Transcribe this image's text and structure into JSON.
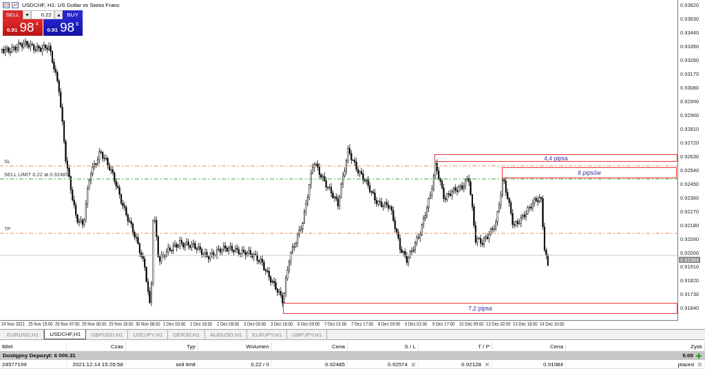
{
  "chart": {
    "title": "USDCHF, H1:  US Dollar vs Swiss Franc",
    "one_click": {
      "sell": {
        "label": "SELL",
        "price_small": "0.91",
        "price_big": "98",
        "price_sup": "4"
      },
      "lot": "0.22",
      "buy": {
        "label": "BUY",
        "price_small": "0.91",
        "price_big": "98",
        "price_sup": "6"
      }
    },
    "price_axis": [
      "0.93620",
      "0.93530",
      "0.93440",
      "0.93350",
      "0.93260",
      "0.93170",
      "0.93080",
      "0.92990",
      "0.92900",
      "0.92810",
      "0.92720",
      "0.92630",
      "0.92540",
      "0.92450",
      "0.92360",
      "0.92270",
      "0.92180",
      "0.92090",
      "0.92000",
      "0.91910",
      "0.91820",
      "0.91730",
      "0.91640"
    ],
    "current_price": "0.91984",
    "time_axis": [
      "24 Nov 2021",
      "25 Nov 15:00",
      "26 Nov 07:00",
      "29 Nov 00:00",
      "29 Nov 16:00",
      "30 Nov 08:00",
      "1 Dec 00:00",
      "1 Dec 16:00",
      "2 Dec 08:00",
      "3 Dec 00:00",
      "3 Dec 16:00",
      "6 Dec 09:00",
      "7 Dec 01:00",
      "7 Dec 17:00",
      "8 Dec 09:00",
      "9 Dec 01:00",
      "9 Dec 17:00",
      "10 Dec 09:00",
      "13 Dec 02:00",
      "13 Dec 18:00",
      "14 Dec 10:00"
    ],
    "levels": [
      {
        "kind": "sl",
        "label": "SL"
      },
      {
        "kind": "order",
        "label": "SELL LIMIT 0.22 at 0.92485"
      },
      {
        "kind": "tp",
        "label": "TP"
      }
    ],
    "annotations": [
      "4,4 pipsa",
      "8 pipsów",
      "7,2 pipsa"
    ]
  },
  "tabs": [
    {
      "label": "EURUSD,H1",
      "selected": false
    },
    {
      "label": "USDCHF,H1",
      "selected": true
    },
    {
      "label": "GBPUSD,H1",
      "selected": false
    },
    {
      "label": "USDJPY,H1",
      "selected": false
    },
    {
      "label": "GER30,H1",
      "selected": false
    },
    {
      "label": "AUDUSD,H1",
      "selected": false
    },
    {
      "label": "EURJPY,H1",
      "selected": false
    },
    {
      "label": "GBPJPY,H1",
      "selected": false
    }
  ],
  "table": {
    "columns": [
      "Bilet",
      "Czas",
      "Typ",
      "Wolumen",
      "Cena",
      "S / L",
      "T / P",
      "Cena",
      "Zysk"
    ],
    "summary": {
      "label": "Dostępny Depozyt: 6 000.31",
      "value": "0.00"
    },
    "rows": [
      {
        "cells": [
          "24577199",
          "2021.12.14 15:26:58",
          "sell limit",
          "0.22 / 0",
          "0.92485",
          "0.92574",
          "0.92128",
          "0.91984",
          "placed"
        ]
      }
    ]
  }
}
